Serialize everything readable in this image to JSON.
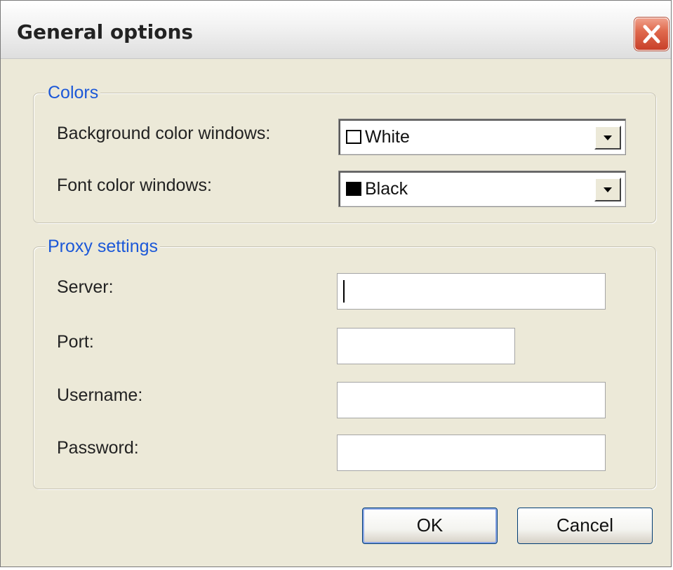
{
  "window": {
    "title": "General options"
  },
  "colors_group": {
    "legend": "Colors",
    "background_label": "Background color windows:",
    "background_value": "White",
    "background_swatch": "#ffffff",
    "font_label": "Font color windows:",
    "font_value": "Black",
    "font_swatch": "#000000"
  },
  "proxy_group": {
    "legend": "Proxy settings",
    "server_label": "Server:",
    "server_value": "",
    "port_label": "Port:",
    "port_value": "",
    "username_label": "Username:",
    "username_value": "",
    "password_label": "Password:",
    "password_value": ""
  },
  "buttons": {
    "ok_label": "OK",
    "cancel_label": "Cancel"
  },
  "icons": {
    "close": "close-icon",
    "dropdown": "chevron-down-icon"
  },
  "theme": {
    "legend_color": "#1c58d8",
    "close_button_color": "#e06a4e"
  }
}
